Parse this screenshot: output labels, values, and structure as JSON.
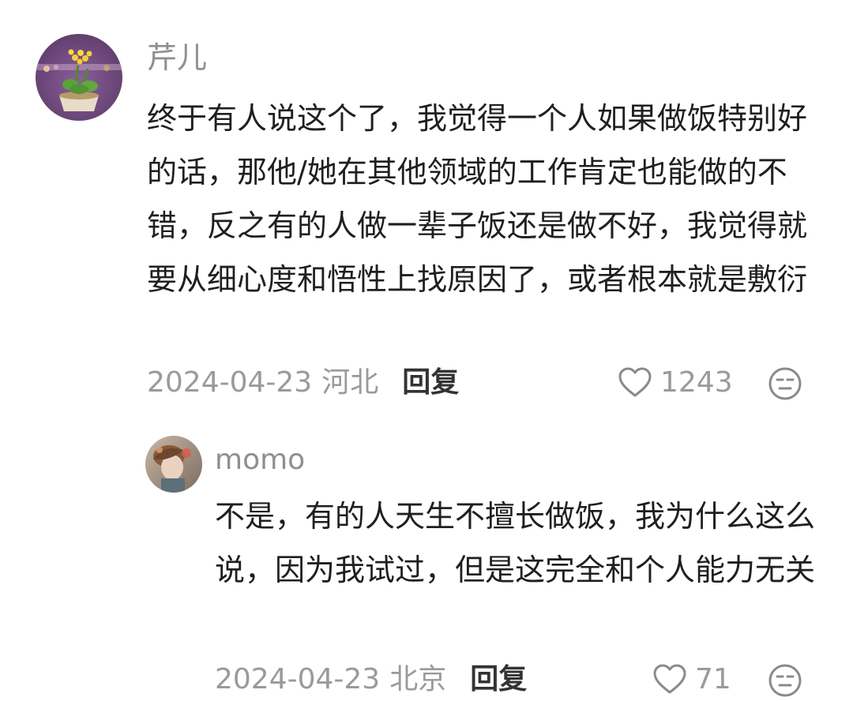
{
  "comments": [
    {
      "username": "芹儿",
      "content": "终于有人说这个了，我觉得一个人如果做饭特别好的话，那他/她在其他领域的工作肯定也能做的不错，反之有的人做一辈子饭还是做不好，我觉得就要从细心度和悟性上找原因了，或者根本就是敷衍",
      "date": "2024-04-23",
      "location": "河北",
      "reply_label": "回复",
      "likes": "1243"
    },
    {
      "username": "momo",
      "content": "不是，有的人天生不擅长做饭，我为什么这么说，因为我试过，但是这完全和个人能力无关",
      "date": "2024-04-23",
      "location": "北京",
      "reply_label": "回复",
      "likes": "71"
    }
  ],
  "icons": {
    "like": "heart-outline-icon",
    "react": "meh-face-icon"
  },
  "colors": {
    "username": "#8f8f8f",
    "content": "#1f1f1f",
    "meta": "#9a9a9a",
    "reply": "#333333"
  }
}
